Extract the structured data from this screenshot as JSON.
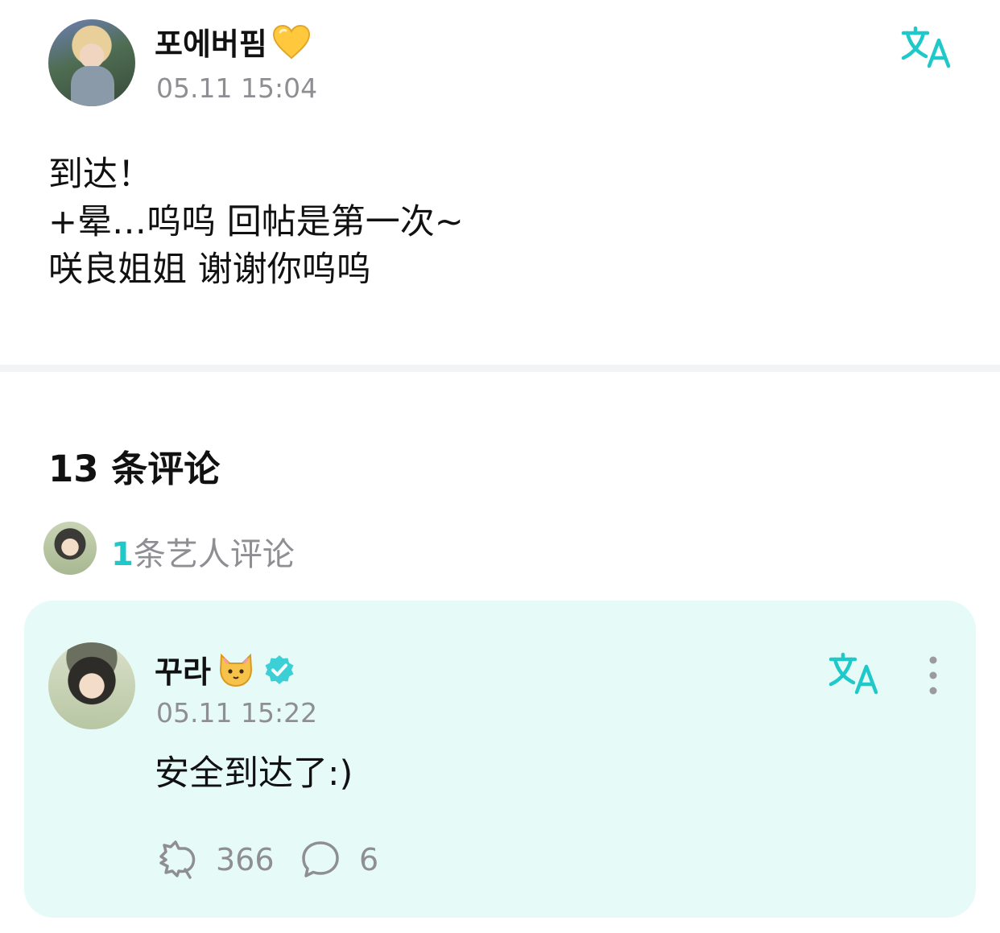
{
  "post": {
    "author": "포에버핌",
    "author_emoji": "yellow-heart-icon",
    "time": "05.11 15:04",
    "body_lines": [
      "到达！",
      "+晕…呜呜 回帖是第一次~",
      "咲良姐姐 谢谢你呜呜"
    ]
  },
  "comments": {
    "title": "13 条评论",
    "artist_count": "1",
    "artist_label": "条艺人评论",
    "items": [
      {
        "author": "꾸라",
        "author_emoji": "cat-face-icon",
        "verified": true,
        "time": "05.11 15:22",
        "text": "安全到达了:)",
        "likes": "366",
        "replies": "6"
      }
    ]
  },
  "colors": {
    "accent": "#1fc9c9",
    "card_background": "#e6fbf8",
    "muted_text": "#8e8e93",
    "divider": "#f2f3f5"
  }
}
